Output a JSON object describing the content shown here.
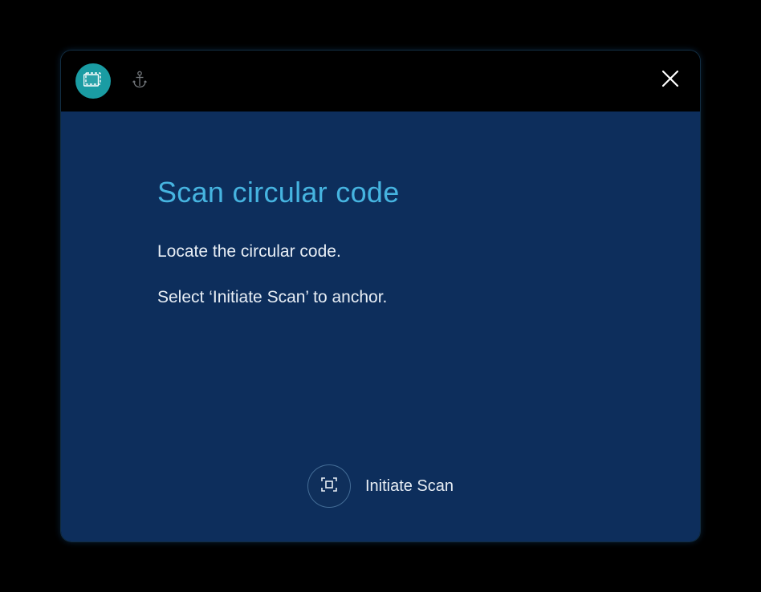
{
  "header": {
    "tabs": [
      {
        "icon": "scan-frame-icon",
        "active": true
      },
      {
        "icon": "anchor-icon",
        "active": false
      }
    ],
    "close": "close-icon"
  },
  "content": {
    "title": "Scan circular code",
    "instruction1": "Locate the circular code.",
    "instruction2": "Select ‘Initiate Scan’ to anchor."
  },
  "action": {
    "scan_label": "Initiate Scan"
  },
  "colors": {
    "accent": "#46b4e0",
    "tab_active": "#1a9ca3",
    "panel_bg": "#0d2e5c"
  }
}
